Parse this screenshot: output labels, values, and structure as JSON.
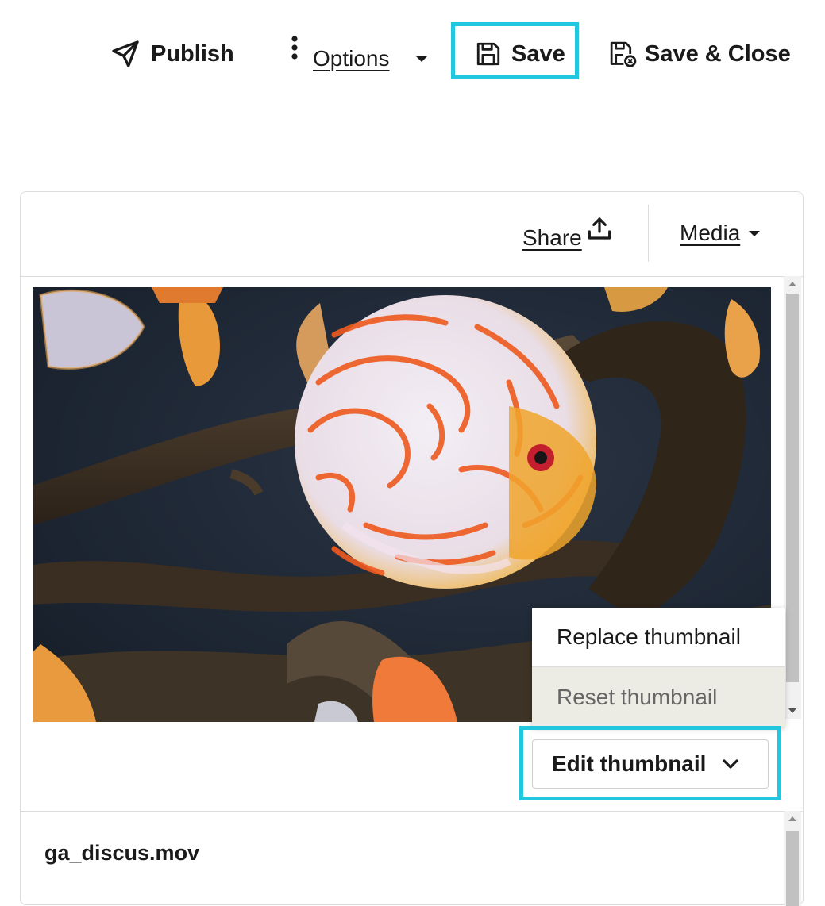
{
  "toolbar": {
    "publish_label": "Publish",
    "options_label": "Options",
    "save_label": "Save",
    "save_close_label": "Save & Close"
  },
  "media_panel": {
    "share_label": "Share",
    "media_label": "Media",
    "thumbnail_menu": {
      "items": [
        {
          "label": "Replace thumbnail",
          "state": "enabled"
        },
        {
          "label": "Reset thumbnail",
          "state": "disabled"
        }
      ]
    },
    "edit_thumbnail_label": "Edit thumbnail",
    "file_name": "ga_discus.mov",
    "thumbnail_subject": "discus fish in aquarium"
  },
  "colors": {
    "highlight": "#22c7df",
    "text": "#1a1a1a",
    "disabled_bg": "#ecebe4",
    "border": "#dcdcdc"
  },
  "icons": [
    "send-icon",
    "more-vertical-icon",
    "caret-down-icon",
    "save-icon",
    "save-close-icon",
    "upload-icon",
    "chevron-down-icon",
    "scroll-up-icon",
    "scroll-down-icon"
  ]
}
